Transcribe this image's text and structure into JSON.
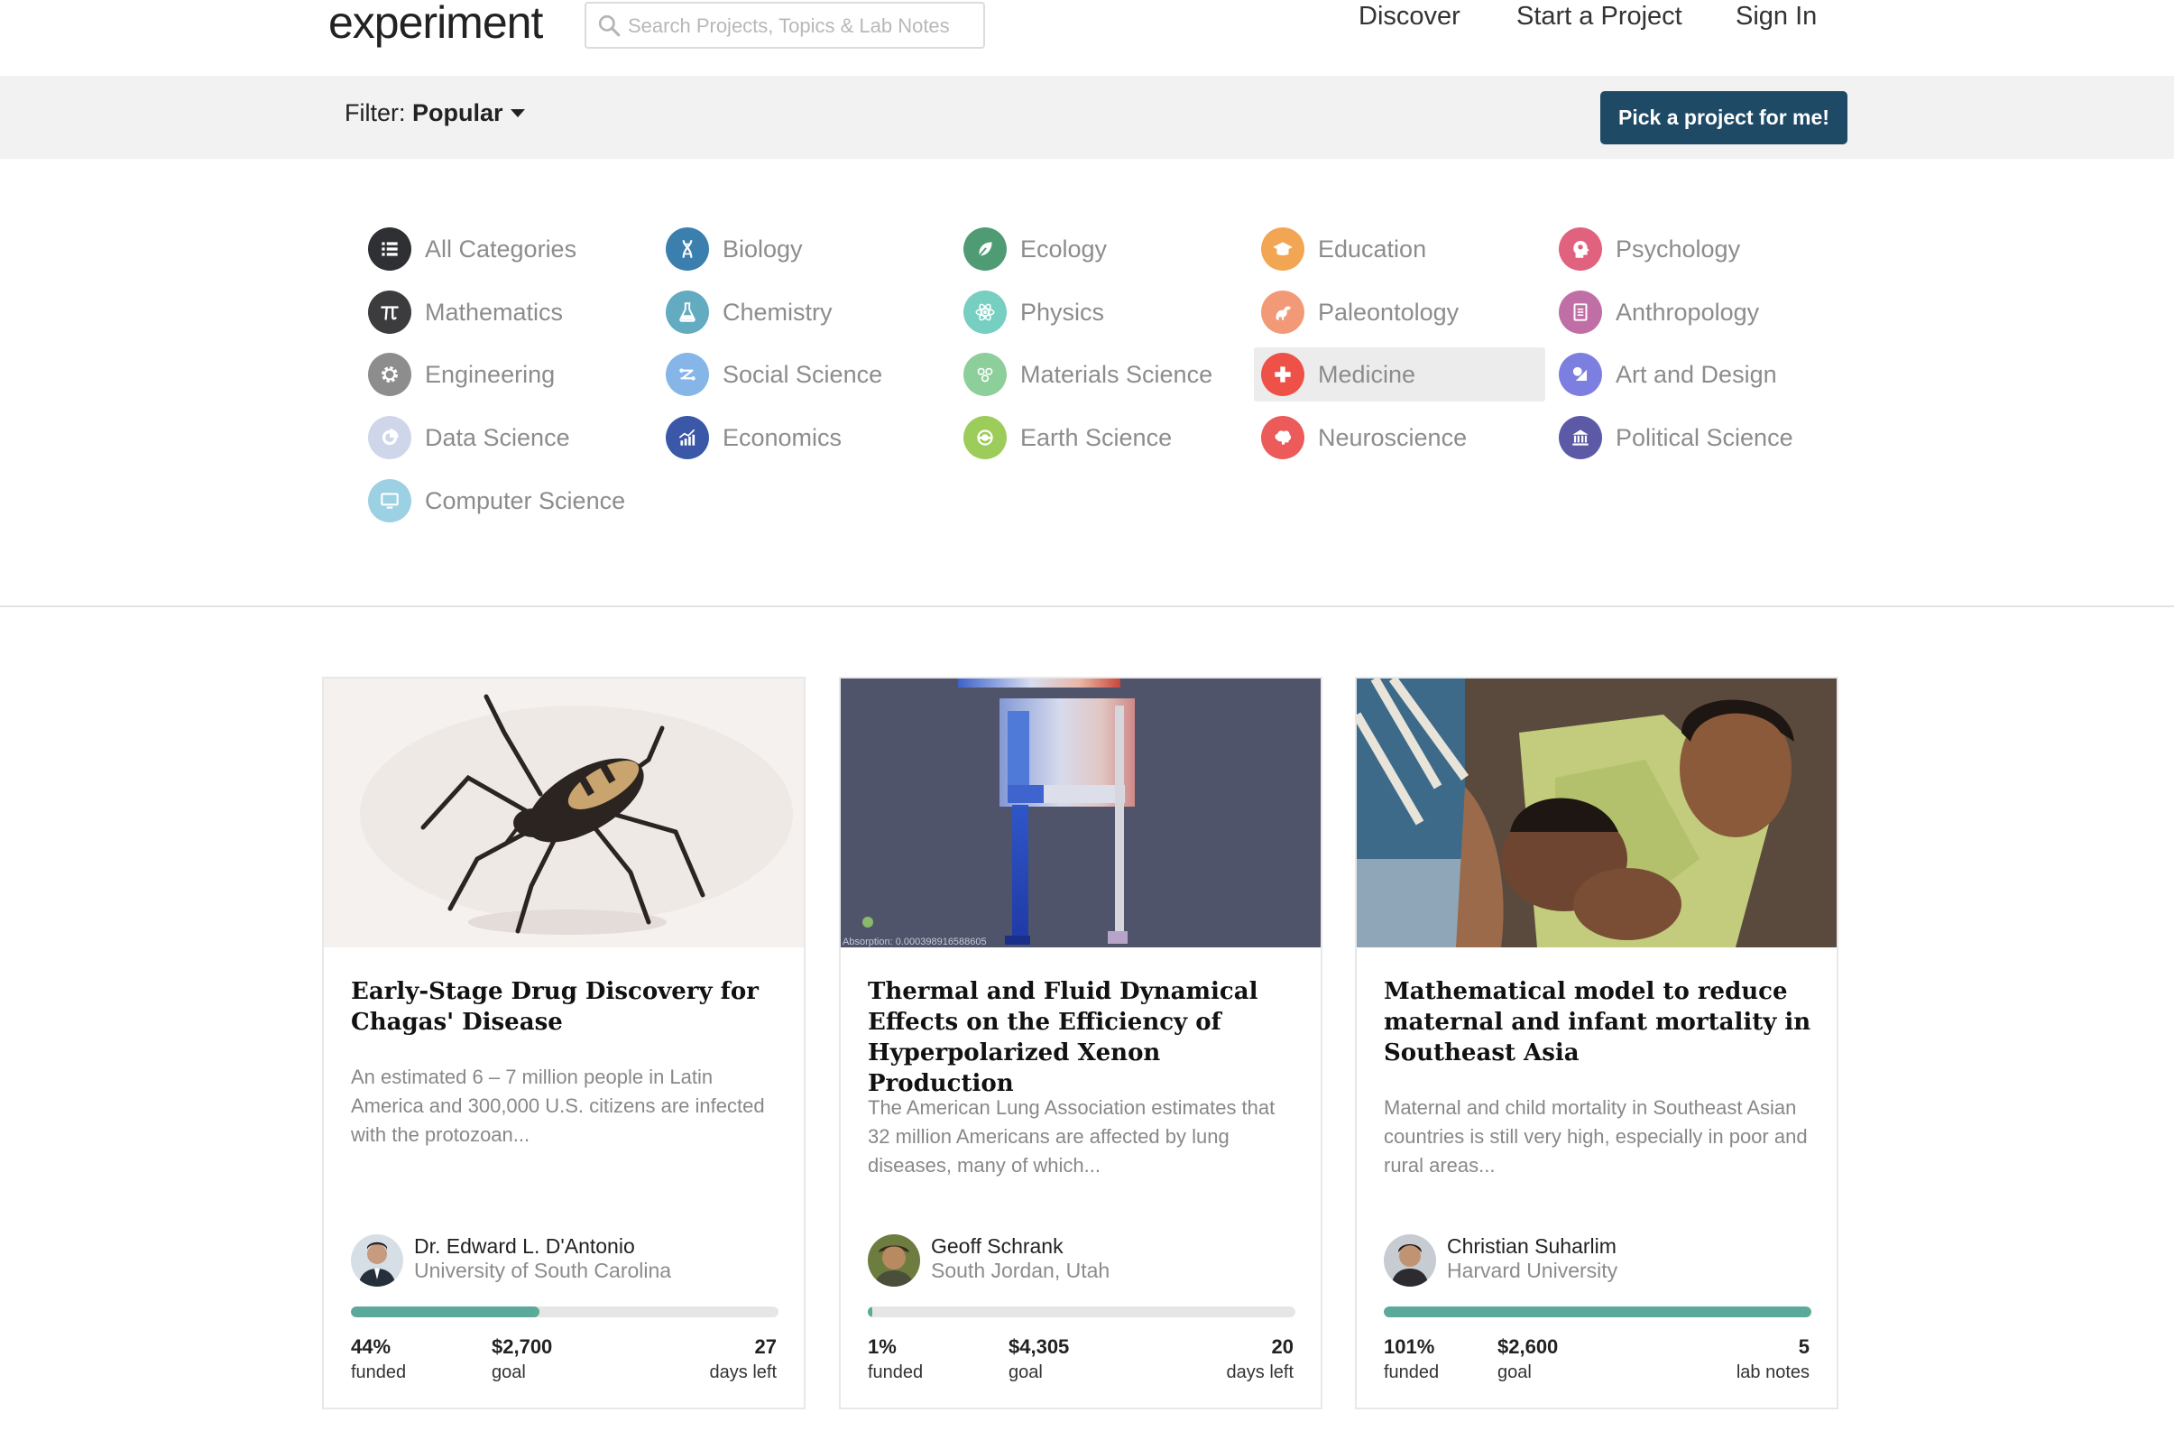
{
  "header": {
    "logo": "experiment",
    "search_placeholder": "Search Projects, Topics & Lab Notes",
    "nav": [
      "Discover",
      "Start a Project",
      "Sign In"
    ]
  },
  "filterbar": {
    "filter_label": "Filter:",
    "filter_value": "Popular",
    "pick_button": "Pick a project for me!"
  },
  "categories": [
    {
      "label": "All Categories",
      "color": "#2f3033",
      "icon": "list-icon"
    },
    {
      "label": "Biology",
      "color": "#3a7fae",
      "icon": "dna-icon"
    },
    {
      "label": "Ecology",
      "color": "#4f9c74",
      "icon": "leaf-icon"
    },
    {
      "label": "Education",
      "color": "#f2a654",
      "icon": "graduation-cap-icon"
    },
    {
      "label": "Psychology",
      "color": "#e0627f",
      "icon": "head-icon"
    },
    {
      "label": "Mathematics",
      "color": "#3c3c3e",
      "icon": "pi-icon"
    },
    {
      "label": "Chemistry",
      "color": "#63abc0",
      "icon": "flask-icon"
    },
    {
      "label": "Physics",
      "color": "#76cfc0",
      "icon": "atom-icon"
    },
    {
      "label": "Paleontology",
      "color": "#f29a78",
      "icon": "dinosaur-icon"
    },
    {
      "label": "Anthropology",
      "color": "#c06fa6",
      "icon": "document-icon"
    },
    {
      "label": "Engineering",
      "color": "#8d8d8d",
      "icon": "gear-icon"
    },
    {
      "label": "Social Science",
      "color": "#86b6e8",
      "icon": "network-icon"
    },
    {
      "label": "Materials Science",
      "color": "#8dcf9b",
      "icon": "molecule-icon"
    },
    {
      "label": "Medicine",
      "color": "#ee5148",
      "icon": "medical-cross-icon"
    },
    {
      "label": "Art and Design",
      "color": "#7d7fe0",
      "icon": "shapes-icon"
    },
    {
      "label": "Data Science",
      "color": "#cfd6ea",
      "icon": "pie-chart-icon"
    },
    {
      "label": "Economics",
      "color": "#3b57a8",
      "icon": "growth-chart-icon"
    },
    {
      "label": "Earth Science",
      "color": "#9ccc5a",
      "icon": "earth-icon"
    },
    {
      "label": "Neuroscience",
      "color": "#ec5a5a",
      "icon": "brain-icon"
    },
    {
      "label": "Political Science",
      "color": "#5c5aa6",
      "icon": "capitol-icon"
    },
    {
      "label": "Computer Science",
      "color": "#9cd0e3",
      "icon": "monitor-icon"
    }
  ],
  "active_category": "Medicine",
  "projects": [
    {
      "title": "Early-Stage Drug Discovery for Chagas' Disease",
      "description": "An estimated 6 – 7 million people in Latin America and 300,000 U.S. citizens are infected with the protozoan...",
      "author": "Dr. Edward L. D'Antonio",
      "affiliation": "University of South Carolina",
      "funded_pct": 44,
      "funded_text": "44%",
      "funded_label": "funded",
      "goal": "$2,700",
      "goal_label": "goal",
      "right_value": "27",
      "right_label": "days left"
    },
    {
      "title": "Thermal and Fluid Dynamical Effects on the Efficiency of Hyperpolarized Xenon Production",
      "description": "The American Lung Association estimates that 32 million Americans are affected by lung diseases, many of which...",
      "author": "Geoff Schrank",
      "affiliation": "South Jordan, Utah",
      "funded_pct": 1,
      "funded_text": "1%",
      "funded_label": "funded",
      "goal": "$4,305",
      "goal_label": "goal",
      "right_value": "20",
      "right_label": "days left",
      "image_caption": "Absorption: 0.000398916588605"
    },
    {
      "title": "Mathematical model to reduce maternal and infant mortality in Southeast Asia",
      "description": "Maternal and child mortality in Southeast Asian countries is still very high, especially in poor and rural areas...",
      "author": "Christian Suharlim",
      "affiliation": "Harvard University",
      "funded_pct": 101,
      "funded_text": "101%",
      "funded_label": "funded",
      "goal": "$2,600",
      "goal_label": "goal",
      "right_value": "5",
      "right_label": "lab notes"
    }
  ]
}
